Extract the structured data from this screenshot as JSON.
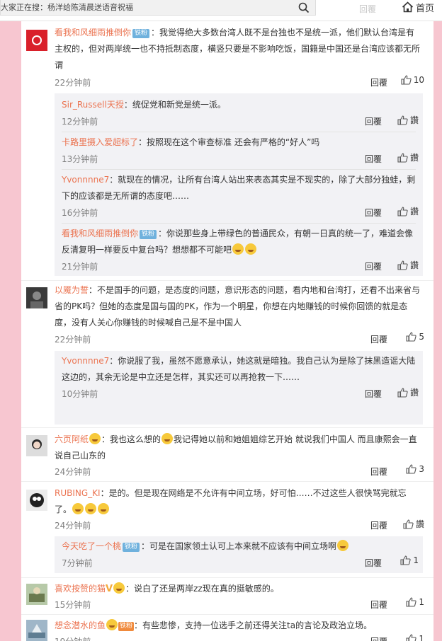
{
  "search": {
    "value": "大家正在搜：杨洋给陈清晨送语音祝福"
  },
  "header": {
    "reply_ghost": "回覆",
    "home_label": "首页"
  },
  "labels": {
    "reply": "回覆",
    "like_word": "讚",
    "badge_fan": "铁粉",
    "badge_vip": "V"
  },
  "comments": [
    {
      "user": "看我和风细雨推倒你",
      "sep": "：",
      "text": "我觉得绝大多数台湾人既不是台独也不是统一派，他们默认台湾是有主权的，但对两岸统一也不持抵制态度，横竖只要是不影响吃饭，国籍是中国还是台湾应该都无所谓",
      "time": "22分钟前",
      "likes": "10",
      "replies": [
        {
          "user": "Sir_Russell天授",
          "sep": "：",
          "text": "统促党和新党是统一派。",
          "time": "12分钟前"
        },
        {
          "user": "卡路里摄入爱超标了",
          "sep": "：",
          "text": "按照现在这个审查标准 还会有严格的“好人”吗",
          "time": "13分钟前"
        },
        {
          "user": "Yvonnnne7",
          "sep": "：",
          "text": "就现在的情况，让所有台湾人站出来表态其实是不现实的，除了大部分独蛙，剩下的应该都是无所谓的态度吧……",
          "time": "16分钟前"
        },
        {
          "user": "看我和风细雨推倒你",
          "sep": "：",
          "text": "你说那些身上带绿色的普通民众，有朝一日真的统一了，难道会像反清复明一样要反中复台吗？想想都不可能吧",
          "time": "21分钟前"
        }
      ]
    },
    {
      "user": "以魇为誓",
      "sep": "：",
      "text": "不是国手的问题，是态度的问题，意识形态的问题，看内地和台湾打，还看不出来省与省的PK吗？但她的态度是国与国的PK，作为一个明星，你想在内地赚钱的时候你回馈的就是态度，没有人关心你赚钱的时候喊自己是不是中国人",
      "time": "22分钟前",
      "likes": "5",
      "replies": [
        {
          "user": "Yvonnnne7",
          "sep": "：",
          "text": "你说服了我，虽然不愿意承认，她这就是暗独。我自己认为是除了抹黑造谣大陆这边的，其余无论是中立还是怎样，其实还可以再抢救一下……",
          "time": "10分钟前"
        }
      ]
    },
    {
      "user": "六页阿纸",
      "sep": "：",
      "text_a": "我也这么想的",
      "text_b": "我记得她以前和她姐姐综艺开始 就说我们中国人 而且康熙会一直说自己山东的",
      "time": "24分钟前",
      "likes": "3"
    },
    {
      "user": "RUBING_KI",
      "sep": "：",
      "text": "是的。但是现在网络是不允许有中间立场，好可怕……不过这些人很快骂完就忘了。",
      "time": "24分钟前",
      "replies": [
        {
          "user": "今天吃了一个桃",
          "sep": "：",
          "text": "可是在国家领土认可上本来就不应该有中间立场啊",
          "time": "7分钟前",
          "likes": "1"
        }
      ]
    },
    {
      "user": "喜欢按赞的猫",
      "sep": "：",
      "text": "说白了还是两岸zz现在真的挺敏感的。",
      "time": "15分钟前",
      "likes": "1"
    },
    {
      "user": "想念潜水的鱼",
      "sep": "：",
      "text": "有些悲惨，支持一位选手之前还得关注ta的言论及政治立场。",
      "time": "19分钟前",
      "likes": "1"
    }
  ]
}
